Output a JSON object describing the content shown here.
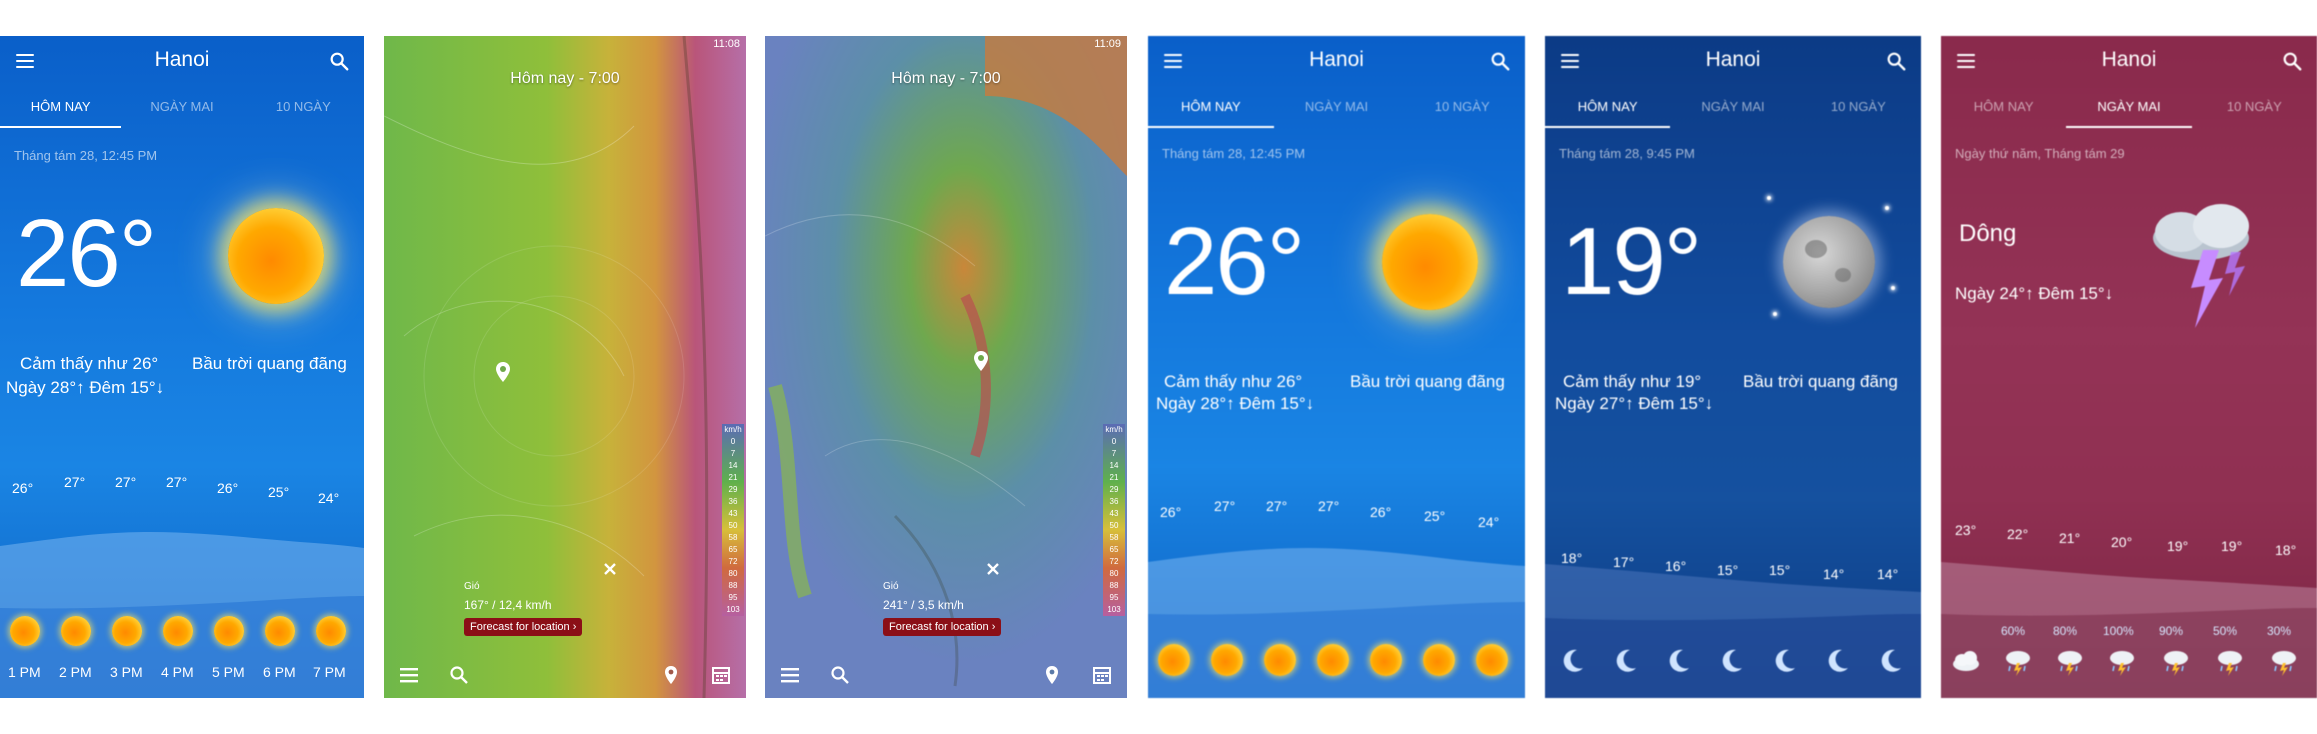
{
  "screens": [
    {
      "city": "Hanoi",
      "tabs": [
        "HÔM NAY",
        "NGÀY MAI",
        "10 NGÀY"
      ],
      "date": "Tháng tám 28, 12:45 PM",
      "temp": "26°",
      "feels": "Cảm thấy như 26°",
      "daynight": "Ngày 28°↑  Đêm 15°↓",
      "desc": "Bầu trời quang đãng",
      "hourly_temps": [
        "26°",
        "27°",
        "27°",
        "27°",
        "26°",
        "25°",
        "24°"
      ],
      "hourly_times": [
        "1 PM",
        "2 PM",
        "3 PM",
        "4 PM",
        "5 PM",
        "6 PM",
        "7 PM"
      ]
    },
    {
      "map_title": "Hôm nay - 7:00",
      "clock": "11:08",
      "wind_label": "Gió",
      "wind_value": "167° / 12,4 km/h",
      "forecast_button": "Forecast for location",
      "legend_unit": "km/h",
      "legend_values": [
        "0",
        "7",
        "14",
        "21",
        "29",
        "36",
        "43",
        "50",
        "58",
        "65",
        "72",
        "80",
        "88",
        "95",
        "103"
      ]
    },
    {
      "map_title": "Hôm nay - 7:00",
      "clock": "11:09",
      "wind_label": "Gió",
      "wind_value": "241° / 3,5 km/h",
      "forecast_button": "Forecast for location",
      "legend_unit": "km/h",
      "legend_values": [
        "0",
        "7",
        "14",
        "21",
        "29",
        "36",
        "43",
        "50",
        "58",
        "65",
        "72",
        "80",
        "88",
        "95",
        "103"
      ]
    },
    {
      "city": "Hanoi",
      "tabs": [
        "HÔM NAY",
        "NGÀY MAI",
        "10 NGÀY"
      ],
      "date": "Tháng tám 28, 12:45 PM",
      "temp": "26°",
      "feels": "Cảm thấy như 26°",
      "daynight": "Ngày 28°↑  Đêm 15°↓",
      "desc": "Bầu trời quang đãng",
      "hourly_temps": [
        "26°",
        "27°",
        "27°",
        "27°",
        "26°",
        "25°",
        "24°"
      ]
    },
    {
      "city": "Hanoi",
      "tabs": [
        "HÔM NAY",
        "NGÀY MAI",
        "10 NGÀY"
      ],
      "date": "Tháng tám 28, 9:45 PM",
      "temp": "19°",
      "feels": "Cảm thấy như 19°",
      "daynight": "Ngày 27°↑  Đêm 15°↓",
      "desc": "Bầu trời quang đãng",
      "hourly_temps": [
        "18°",
        "17°",
        "16°",
        "15°",
        "15°",
        "14°",
        "14°"
      ]
    },
    {
      "city": "Hanoi",
      "tabs": [
        "HÔM NAY",
        "NGÀY MAI",
        "10 NGÀY"
      ],
      "date": "Ngày thứ năm, Tháng tám 29",
      "condition": "Dông",
      "daynight": "Ngày 24°↑  Đêm 15°↓",
      "hourly_temps": [
        "23°",
        "22°",
        "21°",
        "20°",
        "19°",
        "19°",
        "18°"
      ],
      "precip": [
        "60%",
        "80%",
        "100%",
        "90%",
        "50%",
        "30%"
      ]
    }
  ],
  "icons": {
    "menu": "menu-icon",
    "search": "search-icon",
    "sun": "sun-icon",
    "moon": "moon-icon",
    "storm": "thunderstorm-icon",
    "pin": "location-pin-icon",
    "close": "close-icon",
    "calendar": "calendar-icon"
  },
  "colors": {
    "blue_day": "#1478dd",
    "navy_night": "#124c9e",
    "maroon_storm": "#943356",
    "forecast_button": "#8b0f17"
  }
}
